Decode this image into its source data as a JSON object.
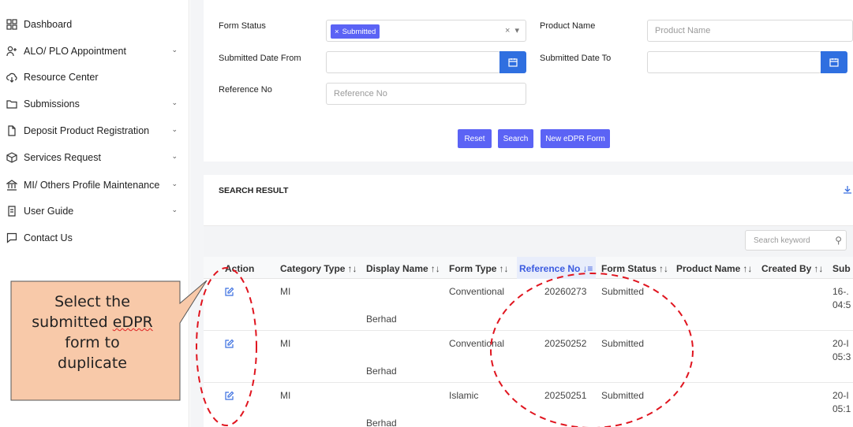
{
  "sidebar": {
    "items": [
      {
        "label": "Dashboard",
        "icon": "grid-icon",
        "chevron": false
      },
      {
        "label": "ALO/ PLO Appointment",
        "icon": "user-add-icon",
        "chevron": true
      },
      {
        "label": "Resource Center",
        "icon": "cloud-download-icon",
        "chevron": false
      },
      {
        "label": "Submissions",
        "icon": "folder-icon",
        "chevron": true
      },
      {
        "label": "Deposit Product Registration",
        "icon": "document-icon",
        "chevron": true
      },
      {
        "label": "Services Request",
        "icon": "box-icon",
        "chevron": true
      },
      {
        "label": "MI/ Others Profile Maintenance",
        "icon": "bank-icon",
        "chevron": true
      },
      {
        "label": "User Guide",
        "icon": "book-icon",
        "chevron": true
      },
      {
        "label": "Contact Us",
        "icon": "chat-icon",
        "chevron": false
      }
    ]
  },
  "filters": {
    "form_status_label": "Form Status",
    "form_status_chip": "Submitted",
    "product_name_label": "Product Name",
    "product_name_placeholder": "Product Name",
    "submitted_from_label": "Submitted Date From",
    "submitted_to_label": "Submitted Date To",
    "reference_no_label": "Reference No",
    "reference_no_placeholder": "Reference No",
    "reset_label": "Reset",
    "search_label": "Search",
    "new_form_label": "New eDPR Form"
  },
  "results": {
    "title": "SEARCH RESULT",
    "search_placeholder": "Search keyword",
    "columns": [
      "Action",
      "Category Type",
      "Display Name",
      "Form Type",
      "Reference No",
      "Form Status",
      "Product Name",
      "Created By",
      "Sub"
    ],
    "rows": [
      {
        "category": "MI",
        "display_name": "Berhad",
        "form_type": "Conventional",
        "reference_no": "20260273",
        "form_status": "Submitted",
        "sub_line1": "16-.",
        "sub_line2": "04:5"
      },
      {
        "category": "MI",
        "display_name": "Berhad",
        "form_type": "Conventional",
        "reference_no": "20250252",
        "form_status": "Submitted",
        "sub_line1": "20-I",
        "sub_line2": "05:3"
      },
      {
        "category": "MI",
        "display_name": "Berhad",
        "form_type": "Islamic",
        "reference_no": "20250251",
        "form_status": "Submitted",
        "sub_line1": "20-I",
        "sub_line2": "05:1"
      }
    ]
  },
  "callout": {
    "line1": "Select the",
    "line2a": "submitted ",
    "line2b": "eDPR",
    "line3": "form to",
    "line4": "duplicate"
  },
  "colors": {
    "accent": "#5b63f5",
    "date_button": "#2f6fe0",
    "callout_fill": "#f8c9a9",
    "dashed_annotation": "#e0151f"
  }
}
